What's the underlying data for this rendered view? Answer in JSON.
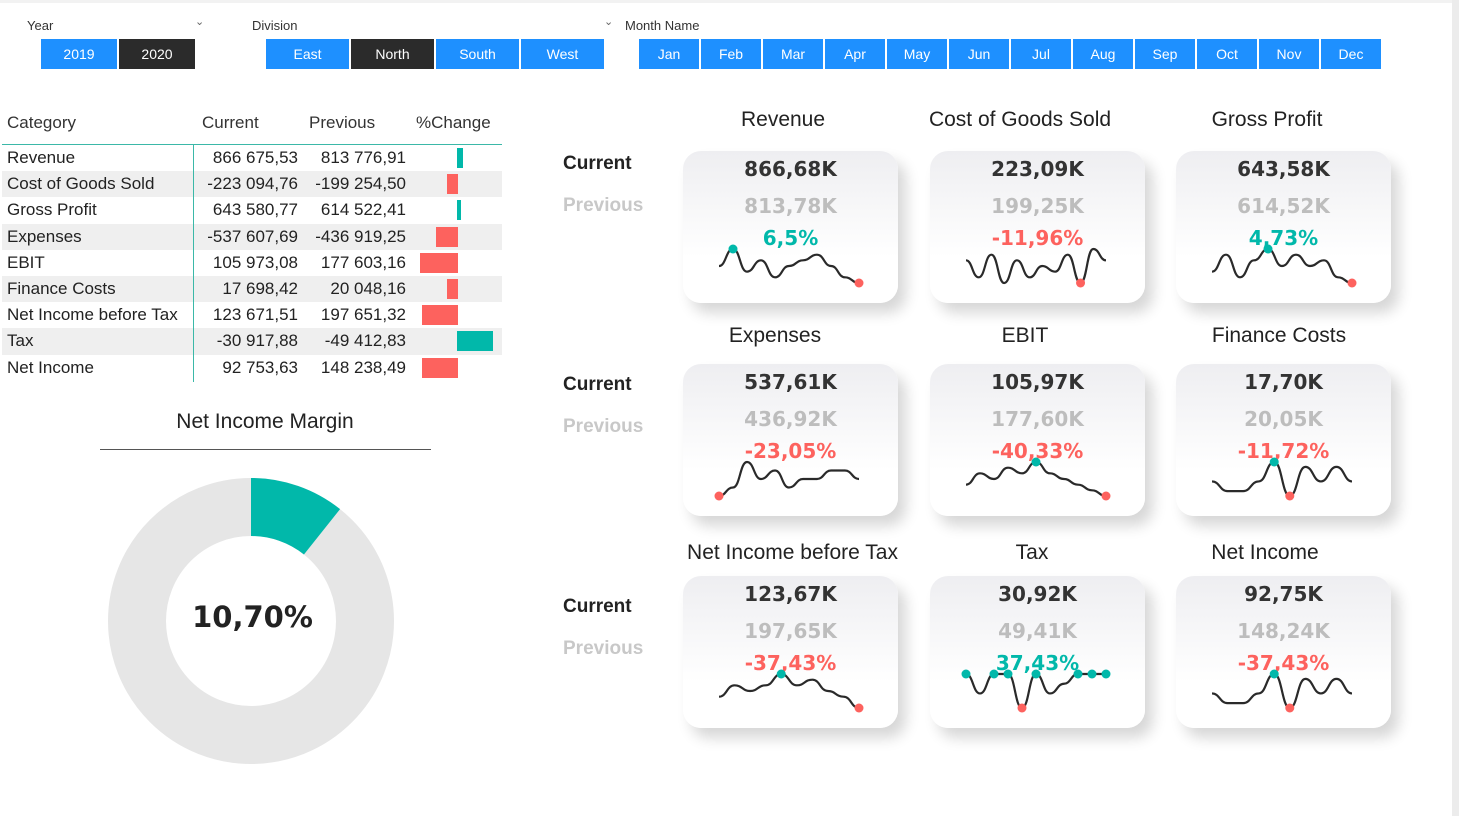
{
  "slicers": {
    "year": {
      "title": "Year",
      "items": [
        "2019",
        "2020"
      ],
      "selected": "2020"
    },
    "division": {
      "title": "Division",
      "items": [
        "East",
        "North",
        "South",
        "West"
      ],
      "selected": "North"
    },
    "month": {
      "title": "Month Name",
      "items": [
        "Jan",
        "Feb",
        "Mar",
        "Apr",
        "May",
        "Jun",
        "Jul",
        "Aug",
        "Sep",
        "Oct",
        "Nov",
        "Dec"
      ]
    }
  },
  "table": {
    "headers": [
      "Category",
      "Current",
      "Previous",
      "%Change"
    ],
    "rows": [
      {
        "category": "Revenue",
        "current": "866 675,53",
        "previous": "813 776,91",
        "change": 6.5
      },
      {
        "category": "Cost of Goods Sold",
        "current": "-223 094,76",
        "previous": "-199 254,50",
        "change": -11.96
      },
      {
        "category": "Gross Profit",
        "current": "643 580,77",
        "previous": "614 522,41",
        "change": 4.73
      },
      {
        "category": "Expenses",
        "current": "-537 607,69",
        "previous": "-436 919,25",
        "change": -23.05
      },
      {
        "category": "EBIT",
        "current": "105 973,08",
        "previous": "177 603,16",
        "change": -40.33
      },
      {
        "category": "Finance Costs",
        "current": "17 698,42",
        "previous": "20 048,16",
        "change": -11.72
      },
      {
        "category": "Net Income before Tax",
        "current": "123 671,51",
        "previous": "197 651,32",
        "change": -37.43
      },
      {
        "category": "Tax",
        "current": "-30 917,88",
        "previous": "-49 412,83",
        "change": 37.43
      },
      {
        "category": "Net Income",
        "current": "92 753,63",
        "previous": "148 238,49",
        "change": -37.43
      }
    ]
  },
  "net_income_margin": {
    "title": "Net Income Margin",
    "value_label": "10,70%",
    "value": 10.7
  },
  "row_labels": {
    "current": "Current",
    "previous": "Previous"
  },
  "colors": {
    "positive": "#01b8aa",
    "negative": "#fd625e",
    "slicer": "#1e90ff",
    "selected": "#2b2b2b"
  },
  "kpis": [
    {
      "title": "Revenue",
      "current": "866,68K",
      "previous": "813,78K",
      "change": "6,5%",
      "trend": "up",
      "spark": [
        3,
        6,
        2,
        4,
        1,
        3,
        4,
        5,
        3,
        1,
        0
      ],
      "markers": {
        "high": [
          1
        ],
        "low": [
          10
        ]
      }
    },
    {
      "title": "Cost of Goods Sold",
      "current": "223,09K",
      "previous": "199,25K",
      "change": "-11,96%",
      "trend": "down",
      "spark": [
        4,
        1,
        5,
        0,
        4,
        1,
        3,
        2,
        5,
        0,
        6,
        4
      ],
      "markers": {
        "high": [],
        "low": [
          9
        ]
      }
    },
    {
      "title": "Gross Profit",
      "current": "643,58K",
      "previous": "614,52K",
      "change": "4,73%",
      "trend": "up",
      "spark": [
        2,
        5,
        1,
        4,
        6,
        3,
        5,
        3,
        4,
        1,
        0
      ],
      "markers": {
        "high": [
          4
        ],
        "low": [
          10
        ]
      }
    },
    {
      "title": "Expenses",
      "current": "537,61K",
      "previous": "436,92K",
      "change": "-23,05%",
      "trend": "down",
      "spark": [
        0,
        1,
        4,
        2,
        3,
        1,
        2,
        2,
        3,
        3,
        2
      ],
      "markers": {
        "high": [],
        "low": [
          0
        ]
      }
    },
    {
      "title": "EBIT",
      "current": "105,97K",
      "previous": "177,60K",
      "change": "-40,33%",
      "trend": "down",
      "spark": [
        3,
        5,
        4,
        6,
        5,
        7,
        5,
        4,
        3,
        2,
        1
      ],
      "markers": {
        "high": [
          5
        ],
        "low": [
          10
        ]
      }
    },
    {
      "title": "Finance Costs",
      "current": "17,70K",
      "previous": "20,05K",
      "change": "-11,72%",
      "trend": "down",
      "spark": [
        3,
        1,
        1,
        3,
        7,
        0,
        6,
        3,
        6,
        3
      ],
      "markers": {
        "high": [
          4
        ],
        "low": [
          5
        ]
      }
    },
    {
      "title": "Net Income before Tax",
      "current": "123,67K",
      "previous": "197,65K",
      "change": "-37,43%",
      "trend": "down",
      "spark": [
        3,
        5,
        4,
        5,
        7,
        5,
        6,
        4,
        3,
        1
      ],
      "markers": {
        "high": [
          4
        ],
        "low": [
          9
        ]
      }
    },
    {
      "title": "Tax",
      "current": "30,92K",
      "previous": "49,41K",
      "change": "37,43%",
      "trend": "up",
      "spark": [
        7,
        3,
        7,
        7,
        0,
        7,
        3,
        5,
        7,
        7,
        7
      ],
      "markers": {
        "high": [
          0,
          2,
          3,
          5,
          8,
          9,
          10
        ],
        "low": [
          4
        ]
      }
    },
    {
      "title": "Net Income",
      "current": "92,75K",
      "previous": "148,24K",
      "change": "-37,43%",
      "trend": "down",
      "spark": [
        3,
        1,
        1,
        3,
        7,
        0,
        6,
        3,
        6,
        3
      ],
      "markers": {
        "high": [
          4
        ],
        "low": [
          5
        ]
      }
    }
  ]
}
